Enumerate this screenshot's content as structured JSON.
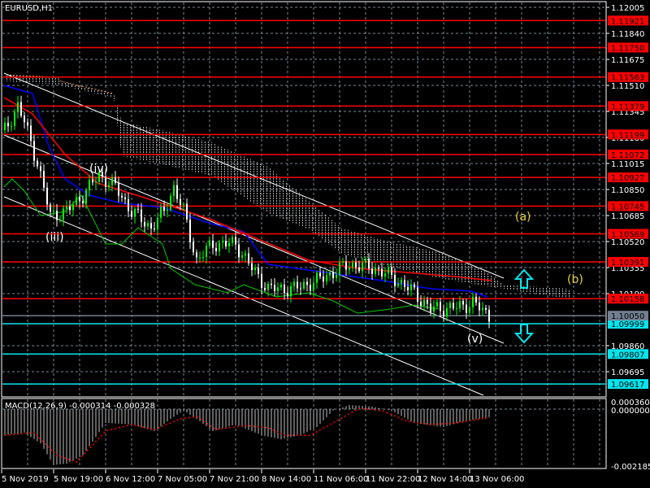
{
  "chart_title": "EURUSD,H1",
  "macd_label": "MACD(12,26,9) -0.000314 -0.000328",
  "colors": {
    "level_red": "#ff0000",
    "level_cyan": "#00e5ee",
    "current": "#708090",
    "grid": "#7a8796",
    "bull": "#00ff00",
    "bear": "#ffffff",
    "ma_red": "#ff0000",
    "ma_blue": "#0000ff",
    "lagging": "#00cc00",
    "wave_yellow": "#e6d23a"
  },
  "price_axis": {
    "ticks": [
      "1.12005",
      "1.11840",
      "1.11675",
      "1.11510",
      "1.11345",
      "1.11180",
      "1.11015",
      "1.10850",
      "1.10685",
      "1.10520",
      "1.10355",
      "1.10190",
      "1.09860",
      "1.09695"
    ]
  },
  "levels_red": [
    "1.11921",
    "1.11750",
    "1.11563",
    "1.11379",
    "1.11199",
    "1.11072",
    "1.10927",
    "1.10745",
    "1.10569",
    "1.10391",
    "1.10158"
  ],
  "levels_cyan": [
    "1.09999",
    "1.09807",
    "1.09617"
  ],
  "current_price": "1.10050",
  "macd_axis": {
    "top": "0.000360",
    "zero": "0.000000",
    "bottom": "-0.002185"
  },
  "time_axis": [
    "5 Nov 2019",
    "5 Nov 19:00",
    "6 Nov 12:00",
    "7 Nov 05:00",
    "7 Nov 21:00",
    "8 Nov 14:00",
    "11 Nov 06:00",
    "11 Nov 22:00",
    "12 Nov 14:00",
    "13 Nov 06:00"
  ],
  "waves": {
    "iii": "(iii)",
    "iv": "(iv)",
    "v": "(v)",
    "a": "(a)",
    "b": "(b)"
  },
  "chart_data": {
    "type": "candlestick",
    "symbol": "EURUSD",
    "timeframe": "H1",
    "ylim": [
      1.0955,
      1.1205
    ],
    "price_path": [
      [
        1,
        1.11226
      ],
      [
        5,
        1.11381
      ],
      [
        7,
        1.11278
      ],
      [
        11,
        1.1102
      ],
      [
        15,
        1.10685
      ],
      [
        20,
        1.10711
      ],
      [
        25,
        1.10814
      ],
      [
        30,
        1.10943
      ],
      [
        35,
        1.10865
      ],
      [
        40,
        1.10711
      ],
      [
        46,
        1.10608
      ],
      [
        50,
        1.10711
      ],
      [
        53,
        1.10865
      ],
      [
        56,
        1.10711
      ],
      [
        60,
        1.10401
      ],
      [
        65,
        1.10505
      ],
      [
        72,
        1.10505
      ],
      [
        77,
        1.1035
      ],
      [
        82,
        1.10221
      ],
      [
        90,
        1.10221
      ],
      [
        97,
        1.10272
      ],
      [
        102,
        1.10324
      ],
      [
        107,
        1.10376
      ],
      [
        115,
        1.1035
      ],
      [
        122,
        1.10272
      ],
      [
        127,
        1.10195
      ],
      [
        132,
        1.10092
      ],
      [
        140,
        1.10102
      ],
      [
        145,
        1.10133
      ],
      [
        150,
        1.1005
      ]
    ],
    "macd_hist": [
      [
        1,
        -0.00102
      ],
      [
        7,
        -0.00092
      ],
      [
        12,
        -0.00134
      ],
      [
        16,
        -0.00219
      ],
      [
        20,
        -0.00213
      ],
      [
        25,
        -0.00181
      ],
      [
        32,
        -0.00054
      ],
      [
        40,
        -0.0006
      ],
      [
        47,
        -0.00086
      ],
      [
        52,
        -0.00038
      ],
      [
        56,
        -6e-05
      ],
      [
        60,
        -0.00038
      ],
      [
        65,
        -0.00086
      ],
      [
        72,
        -0.0006
      ],
      [
        80,
        -0.00102
      ],
      [
        86,
        -0.00118
      ],
      [
        92,
        -0.00102
      ],
      [
        97,
        -0.0007
      ],
      [
        102,
        -6e-05
      ],
      [
        107,
        0.00016
      ],
      [
        114,
        0.0001
      ],
      [
        120,
        -6e-05
      ],
      [
        127,
        -0.00054
      ],
      [
        136,
        -0.0007
      ],
      [
        142,
        -0.00048
      ],
      [
        150,
        -0.000314
      ]
    ],
    "macd_signal": [
      [
        1,
        -0.00102
      ],
      [
        10,
        -0.00092
      ],
      [
        17,
        -0.00181
      ],
      [
        23,
        -0.00207
      ],
      [
        32,
        -0.00086
      ],
      [
        40,
        -0.0006
      ],
      [
        47,
        -0.0008
      ],
      [
        55,
        -0.00038
      ],
      [
        60,
        -0.00029
      ],
      [
        66,
        -0.0008
      ],
      [
        75,
        -0.00064
      ],
      [
        82,
        -0.00073
      ],
      [
        87,
        -0.00102
      ],
      [
        95,
        -0.00102
      ],
      [
        102,
        -0.00054
      ],
      [
        110,
        3e-05
      ],
      [
        117,
        -6e-05
      ],
      [
        125,
        -0.00048
      ],
      [
        132,
        -0.0006
      ],
      [
        140,
        -0.00054
      ],
      [
        150,
        -0.000328
      ]
    ],
    "macd_ylim": [
      -0.002185,
      0.00036
    ]
  }
}
